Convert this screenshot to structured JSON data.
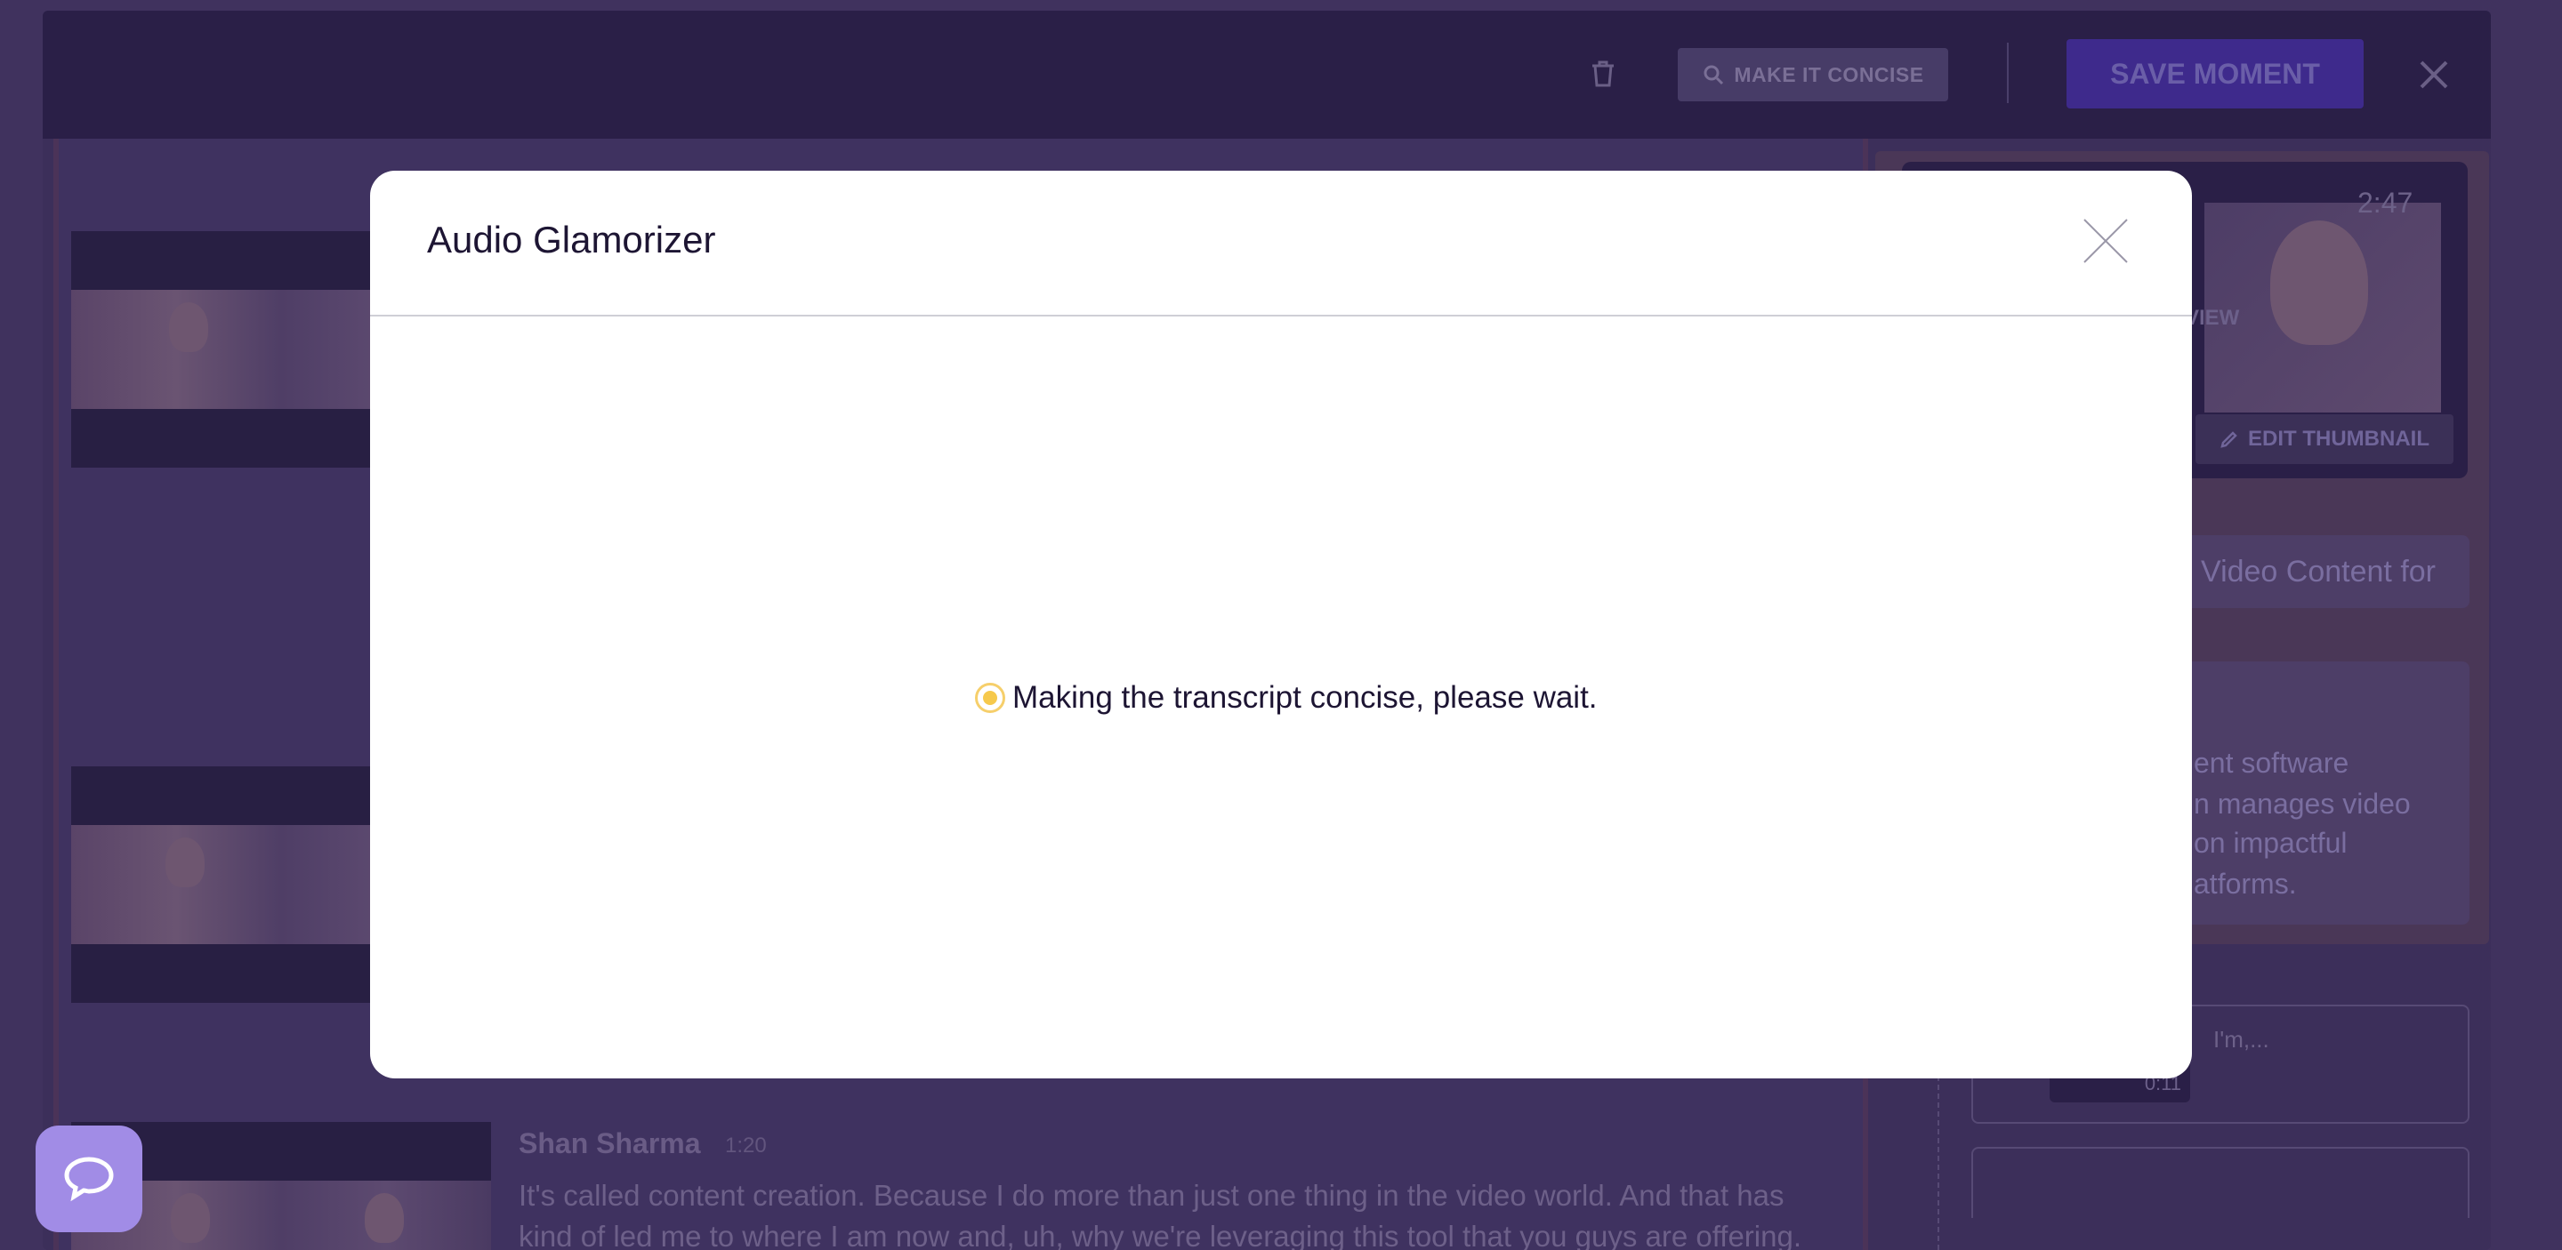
{
  "modal": {
    "title": "Audio Glamorizer",
    "loading_message": "Making the transcript concise, please wait."
  },
  "toolbar": {
    "make_concise_label": "MAKE IT CONCISE",
    "save_label": "SAVE MOMENT"
  },
  "preview": {
    "duration": "2:47",
    "view_label": "VIEW",
    "edit_thumbnail_label": "EDIT THUMBNAIL"
  },
  "details": {
    "title_fragment": "Video Content for",
    "description_lines": [
      "ent software",
      "n manages video",
      "on impactful",
      "atforms."
    ]
  },
  "moments": [
    {
      "duration": "0:11",
      "text": "I'm,..."
    }
  ],
  "transcript": {
    "speaker": "Shan Sharma",
    "timestamp": "1:20",
    "lines": [
      "It's called content creation. Because I do more than just one thing in the video world. And that has",
      "kind of led me to where I am now and, uh, why we're leveraging this tool that you guys are offering."
    ]
  }
}
